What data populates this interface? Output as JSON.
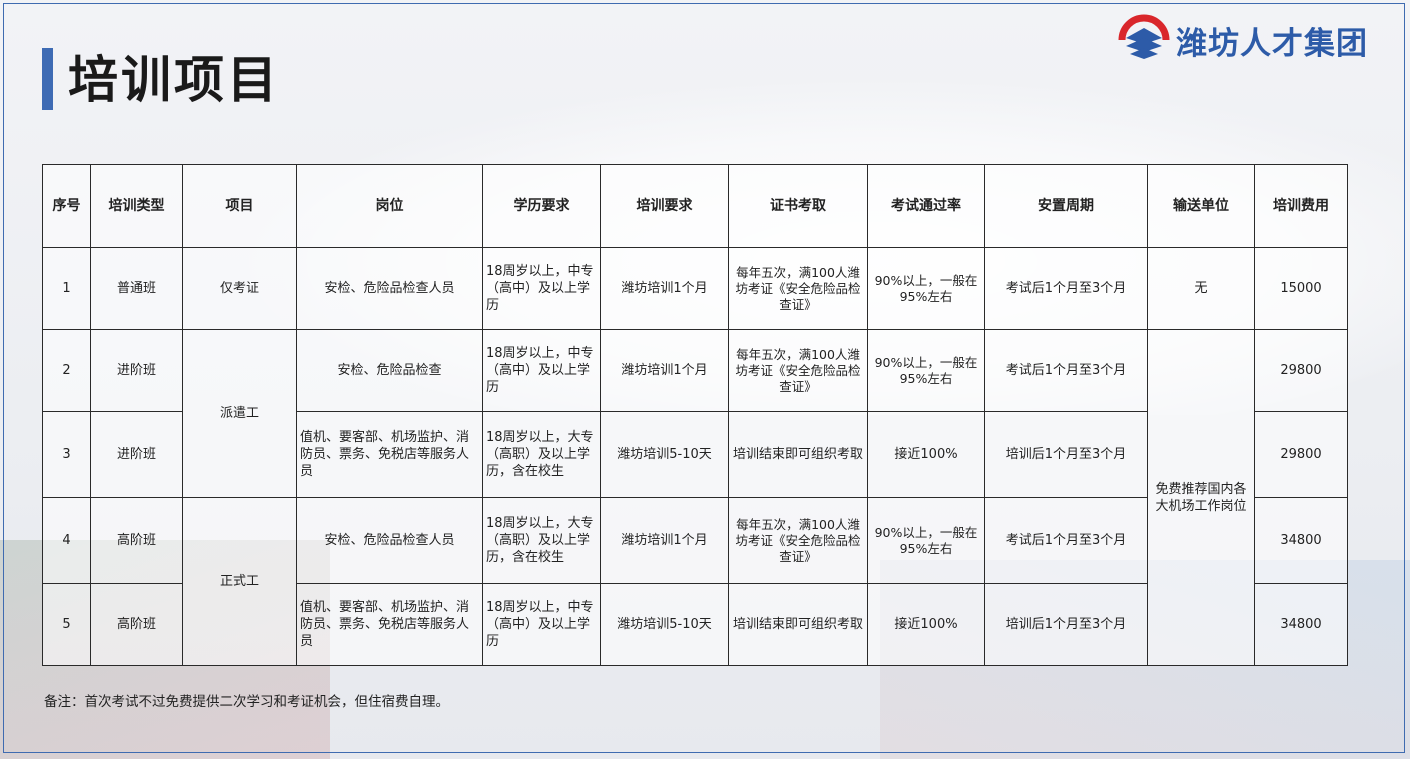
{
  "page": {
    "title": "培训项目",
    "logo_text": "潍坊人才集团",
    "note": "备注：首次考试不过免费提供二次学习和考证机会，但住宿费自理。"
  },
  "colors": {
    "accent": "#3e6bb4",
    "logo_red": "#d9262b",
    "logo_blue": "#2d5ba8"
  },
  "table": {
    "headers": [
      "序号",
      "培训类型",
      "项目",
      "岗位",
      "学历要求",
      "培训要求",
      "证书考取",
      "考试通过率",
      "安置周期",
      "输送单位",
      "培训费用"
    ],
    "rows": [
      {
        "no": "1",
        "type": "普通班",
        "position": "安检、危险品检查人员",
        "education": "18周岁以上，中专（高中）及以上学历",
        "training": "潍坊培训1个月",
        "cert": "每年五次，满100人潍坊考证《安全危险品检查证》",
        "pass": "90%以上，一般在95%左右",
        "placement": "考试后1个月至3个月",
        "fee": "15000"
      },
      {
        "no": "2",
        "type": "进阶班",
        "position": "安检、危险品检查",
        "education": "18周岁以上，中专（高中）及以上学历",
        "training": "潍坊培训1个月",
        "cert": "每年五次，满100人潍坊考证《安全危险品检查证》",
        "pass": "90%以上，一般在95%左右",
        "placement": "考试后1个月至3个月",
        "fee": "29800"
      },
      {
        "no": "3",
        "type": "进阶班",
        "position": "值机、要客部、机场监护、消防员、票务、免税店等服务人员",
        "education": "18周岁以上，大专（高职）及以上学历，含在校生",
        "training": "潍坊培训5-10天",
        "cert": "培训结束即可组织考取",
        "pass": "接近100%",
        "placement": "培训后1个月至3个月",
        "fee": "29800"
      },
      {
        "no": "4",
        "type": "高阶班",
        "position": "安检、危险品检查人员",
        "education": "18周岁以上，大专（高职）及以上学历，含在校生",
        "training": "潍坊培训1个月",
        "cert": "每年五次，满100人潍坊考证《安全危险品检查证》",
        "pass": "90%以上，一般在95%左右",
        "placement": "考试后1个月至3个月",
        "fee": "34800"
      },
      {
        "no": "5",
        "type": "高阶班",
        "position": "值机、要客部、机场监护、消防员、票务、免税店等服务人员",
        "education": "18周岁以上，中专（高中）及以上学历",
        "training": "潍坊培训5-10天",
        "cert": "培训结束即可组织考取",
        "pass": "接近100%",
        "placement": "培训后1个月至3个月",
        "fee": "34800"
      }
    ],
    "projects": [
      "仅考证",
      "派遣工",
      "正式工"
    ],
    "units": [
      "无",
      "免费推荐国内各大机场工作岗位"
    ]
  }
}
